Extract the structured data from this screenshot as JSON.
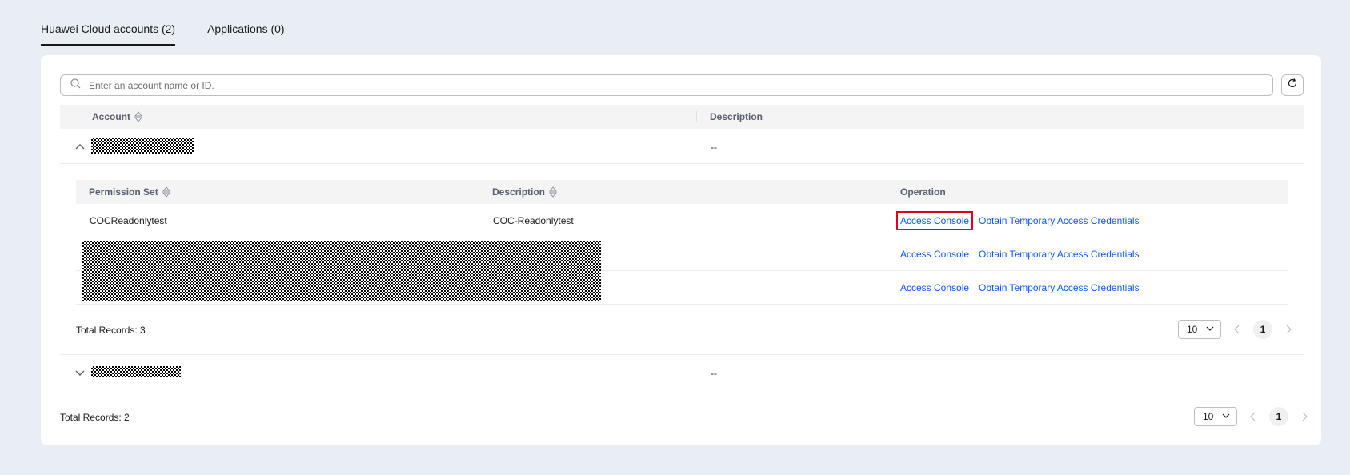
{
  "tabs": [
    {
      "label": "Huawei Cloud accounts (2)",
      "active": true
    },
    {
      "label": "Applications (0)",
      "active": false
    }
  ],
  "search": {
    "placeholder": "Enter an account name or ID."
  },
  "accounts_table": {
    "columns": {
      "account": "Account",
      "description": "Description"
    },
    "rows": [
      {
        "expanded": true,
        "description": "--"
      },
      {
        "expanded": false,
        "description": "--"
      }
    ],
    "total_records": "Total Records: 2",
    "page_size": "10",
    "current_page": "1"
  },
  "permissions_table": {
    "columns": {
      "permission_set": "Permission Set",
      "description": "Description",
      "operation": "Operation"
    },
    "rows": [
      {
        "permission_set": "COCReadonlytest",
        "description": "COC-Readonlytest",
        "access_console": "Access Console",
        "obtain_credentials": "Obtain Temporary Access Credentials"
      },
      {
        "permission_set": "",
        "description": "",
        "access_console": "Access Console",
        "obtain_credentials": "Obtain Temporary Access Credentials"
      },
      {
        "permission_set": "",
        "description": "",
        "access_console": "Access Console",
        "obtain_credentials": "Obtain Temporary Access Credentials"
      }
    ],
    "total_records": "Total Records: 3",
    "page_size": "10",
    "current_page": "1"
  },
  "colors": {
    "background": "#e9edf4",
    "link": "#0a59f7",
    "highlight": "#e0001b"
  },
  "icons": {
    "search": "search-icon",
    "refresh": "refresh-icon",
    "sort": "sort-icon",
    "expand": "chevron-up-icon",
    "collapse": "chevron-down-icon"
  }
}
